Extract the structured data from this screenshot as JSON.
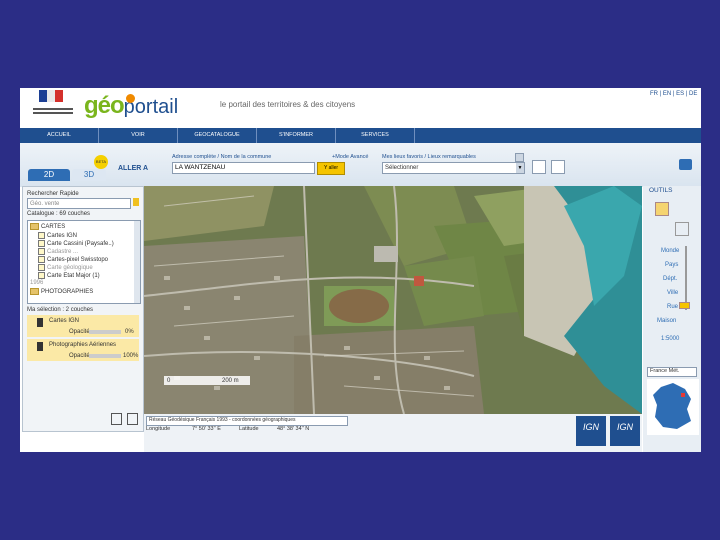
{
  "header": {
    "logo_geo": "géo",
    "logo_portail": "portail",
    "tagline": "le portail des territoires & des citoyens",
    "langs": "FR | EN | ES | DE"
  },
  "nav": [
    "ACCUEIL",
    "VOIR",
    "GEOCATALOGUE",
    "S'INFORMER",
    "SERVICES"
  ],
  "toolbar": {
    "tab_2d": "2D",
    "tab_3d": "3D",
    "beta": "BETA",
    "aller_a": "ALLER A",
    "address_label": "Adresse complète / Nom de la commune",
    "mode_avance": "+Mode Avancé",
    "address_value": "LA WANTZENAU",
    "go_button": "Y aller",
    "places_label": "Mes lieux favoris / Lieux remarquables",
    "places_select": "Sélectionner"
  },
  "left": {
    "search_label": "Rechercher Rapide",
    "search_placeholder": "Géo. vente",
    "catalogue": "Catalogue : 69 couches",
    "folder_cartes": "CARTES",
    "items": [
      "Cartes IGN",
      "Carte Cassini (Paysafe..)",
      "Cadastre ...",
      "Cartes-pixel Swisstopo",
      "Carte géologique",
      "Carte Etat Major (1)"
    ],
    "item_year": "1996",
    "folder_photos": "PHOTOGRAPHIES",
    "selection": "Ma sélection : 2 couches",
    "layer1": "Cartes IGN",
    "opacity_label": "Opacité",
    "opacity1": "0%",
    "layer2": "Photographies Aériennes",
    "opacity2": "100%"
  },
  "map": {
    "scale_zero": "0",
    "scale_value": "200 m"
  },
  "bottom": {
    "crs": "Réseau Géodésique Français 1993 - coordonnées géographiques",
    "lon_label": "Longitude",
    "lon_value": "7° 50' 33'' E",
    "lat_label": "Latitude",
    "lat_value": "48° 38' 34'' N",
    "ign1": "IGN",
    "ign2": "IGN"
  },
  "right": {
    "outils": "OUTILS",
    "zoom_labels": [
      "Monde",
      "Pays",
      "Dépt.",
      "Ville",
      "Rue"
    ],
    "maison": "Maison",
    "scale": "1:5000",
    "country": "France Mét."
  },
  "colors": {
    "background": "#2b2d86",
    "nav": "#1f4f8f",
    "accent_orange": "#f08a00",
    "accent_green": "#7ab51d"
  }
}
